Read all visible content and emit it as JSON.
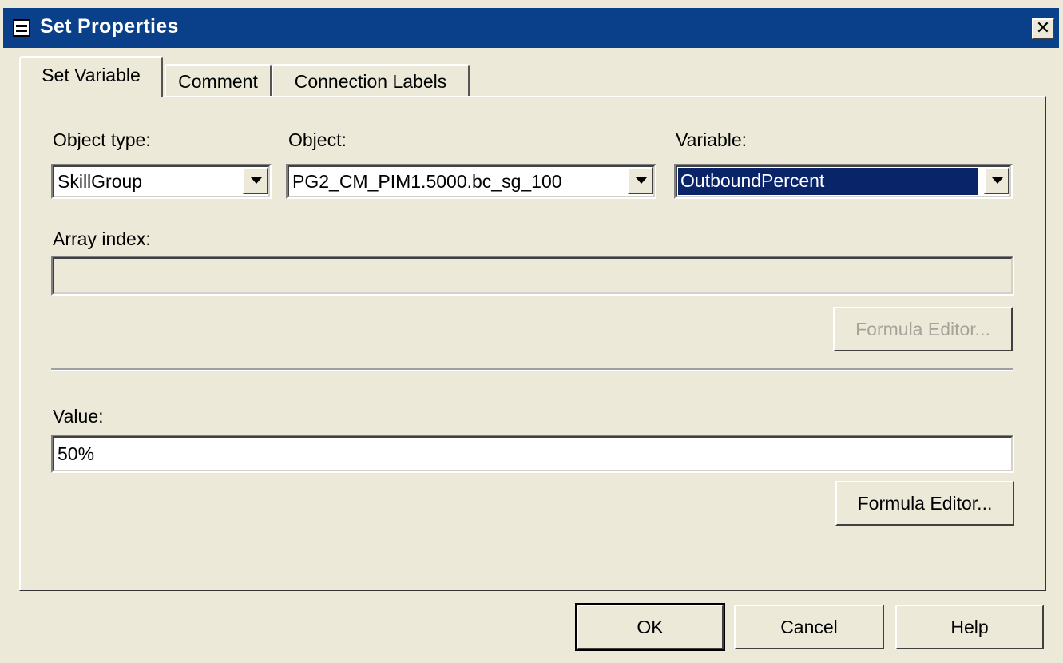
{
  "window": {
    "title": "Set Properties",
    "close_glyph": "✕"
  },
  "tabs": [
    {
      "label": "Set Variable"
    },
    {
      "label": "Comment"
    },
    {
      "label": "Connection Labels"
    }
  ],
  "form": {
    "object_type": {
      "label": "Object type:",
      "value": "SkillGroup"
    },
    "object": {
      "label": "Object:",
      "value": "PG2_CM_PIM1.5000.bc_sg_100"
    },
    "variable": {
      "label": "Variable:",
      "value": "OutboundPercent"
    },
    "array_index": {
      "label": "Array index:",
      "value": ""
    },
    "formula_editor_1": "Formula Editor...",
    "value": {
      "label": "Value:",
      "value": "50%"
    },
    "formula_editor_2": "Formula Editor..."
  },
  "buttons": {
    "ok": "OK",
    "cancel": "Cancel",
    "help": "Help"
  },
  "colors": {
    "titlebar": "#0a3f8a",
    "dialog_bg": "#ece9d8",
    "selection": "#0a246a",
    "disabled_text": "#a6a39a"
  }
}
